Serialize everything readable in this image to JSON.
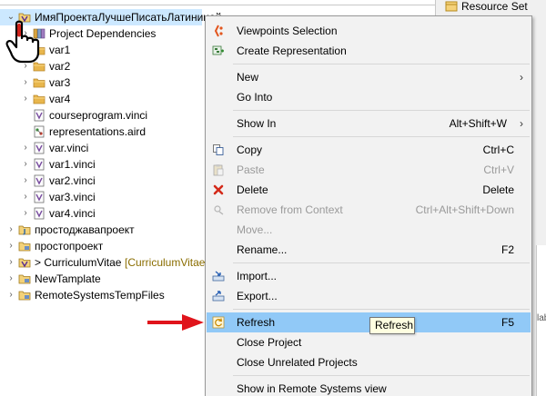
{
  "tree": {
    "items": [
      {
        "label": "ИмяПроектаЛучшеПисатьЛатиницей",
        "icon": "vinci-project-icon",
        "twisty": "expanded",
        "selected": true
      },
      {
        "label": "Project Dependencies",
        "icon": "library-icon",
        "twisty": "collapsed"
      },
      {
        "label": "var1",
        "icon": "folder-icon",
        "twisty": "collapsed"
      },
      {
        "label": "var2",
        "icon": "folder-icon",
        "twisty": "collapsed"
      },
      {
        "label": "var3",
        "icon": "folder-icon",
        "twisty": "collapsed"
      },
      {
        "label": "var4",
        "icon": "folder-icon",
        "twisty": "collapsed"
      },
      {
        "label": "courseprogram.vinci",
        "icon": "vinci-file-icon",
        "twisty": "none"
      },
      {
        "label": "representations.aird",
        "icon": "aird-file-icon",
        "twisty": "none"
      },
      {
        "label": "var.vinci",
        "icon": "vinci-file-icon",
        "twisty": "collapsed"
      },
      {
        "label": "var1.vinci",
        "icon": "vinci-file-icon",
        "twisty": "collapsed"
      },
      {
        "label": "var2.vinci",
        "icon": "vinci-file-icon",
        "twisty": "collapsed"
      },
      {
        "label": "var3.vinci",
        "icon": "vinci-file-icon",
        "twisty": "collapsed"
      },
      {
        "label": "var4.vinci",
        "icon": "vinci-file-icon",
        "twisty": "collapsed"
      },
      {
        "label": "простоджавапроект",
        "icon": "java-project-icon",
        "twisty": "collapsed"
      },
      {
        "label": "простопроект",
        "icon": "project-icon",
        "twisty": "collapsed"
      },
      {
        "label": "> CurriculumVitae",
        "decoration": "[CurriculumVitae]",
        "icon": "vinci-project-icon",
        "twisty": "collapsed"
      },
      {
        "label": "NewTamplate",
        "icon": "project-icon",
        "twisty": "collapsed"
      },
      {
        "label": "RemoteSystemsTempFiles",
        "icon": "project-icon",
        "twisty": "collapsed"
      }
    ]
  },
  "right_panel": {
    "tab_label": "Resource Set",
    "hint": "lab"
  },
  "context_menu": {
    "items": [
      {
        "label": "Viewpoints Selection",
        "icon": "viewpoints-icon",
        "shortcut": ""
      },
      {
        "label": "Create Representation",
        "icon": "create-representation-icon",
        "shortcut": ""
      },
      {
        "separator": true
      },
      {
        "label": "New",
        "icon": "",
        "shortcut": "",
        "submenu": "›"
      },
      {
        "label": "Go Into",
        "icon": "",
        "shortcut": ""
      },
      {
        "separator": true
      },
      {
        "label": "Show In",
        "icon": "",
        "shortcut": "Alt+Shift+W",
        "submenu": "›"
      },
      {
        "separator": true
      },
      {
        "label": "Copy",
        "icon": "copy-icon",
        "shortcut": "Ctrl+C"
      },
      {
        "label": "Paste",
        "icon": "paste-icon",
        "shortcut": "Ctrl+V",
        "disabled": true
      },
      {
        "label": "Delete",
        "icon": "delete-icon",
        "shortcut": "Delete"
      },
      {
        "label": "Remove from Context",
        "icon": "remove-context-icon",
        "shortcut": "Ctrl+Alt+Shift+Down",
        "disabled": true
      },
      {
        "label": "Move...",
        "icon": "",
        "shortcut": "",
        "disabled": true
      },
      {
        "label": "Rename...",
        "icon": "",
        "shortcut": "F2"
      },
      {
        "separator": true
      },
      {
        "label": "Import...",
        "icon": "import-icon",
        "shortcut": ""
      },
      {
        "label": "Export...",
        "icon": "export-icon",
        "shortcut": ""
      },
      {
        "separator": true
      },
      {
        "label": "Refresh",
        "icon": "refresh-icon",
        "shortcut": "F5",
        "highlighted": true
      },
      {
        "label": "Close Project",
        "icon": "",
        "shortcut": ""
      },
      {
        "label": "Close Unrelated Projects",
        "icon": "",
        "shortcut": ""
      },
      {
        "separator": true
      },
      {
        "label": "Show in Remote Systems view",
        "icon": "",
        "shortcut": ""
      }
    ]
  },
  "tooltip": {
    "text": "Refresh"
  },
  "colors": {
    "selection": "#cce8ff",
    "menu_highlight": "#91c9f7",
    "menu_bg": "#f2f2f2",
    "arrow": "#e0141b",
    "tooltip_bg": "#ffffe1",
    "folder": "#e8b64c"
  }
}
